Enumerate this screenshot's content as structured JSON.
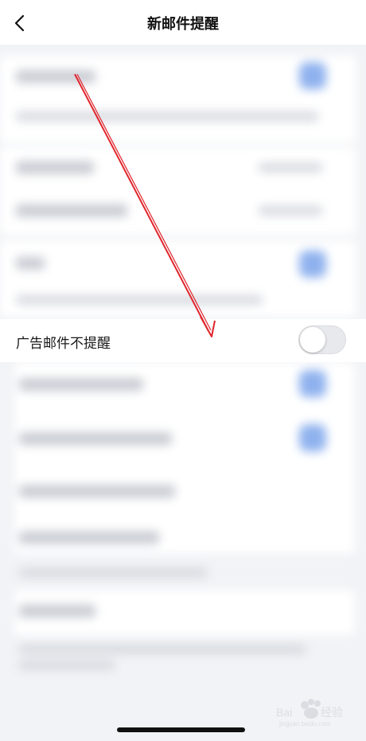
{
  "header": {
    "title": "新邮件提醒"
  },
  "settings": {
    "ad_mail_no_alert_label": "广告邮件不提醒",
    "ad_mail_no_alert_enabled": false
  },
  "icons": {
    "back": "chevron-left-icon",
    "watermark": "baidu-jingyan-logo"
  },
  "colors": {
    "accent_blur": "#8fb2ee",
    "annotation_arrow": "#e0252b",
    "background": "#f2f3f6"
  }
}
